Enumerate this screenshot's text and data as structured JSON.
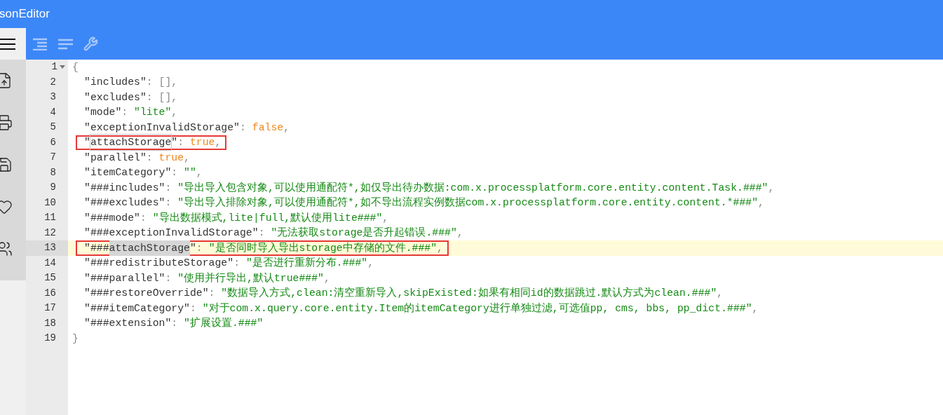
{
  "window": {
    "title": "sonEditor"
  },
  "editor": {
    "open": {
      "number": "1",
      "text": "{"
    },
    "entries": [
      {
        "number": "2",
        "active": false,
        "framed": false,
        "tokens": [
          {
            "kind": "key",
            "text": "\"includes\""
          },
          {
            "kind": "punct",
            "text": ": "
          },
          {
            "kind": "punct",
            "text": "[],"
          }
        ]
      },
      {
        "number": "3",
        "active": false,
        "framed": false,
        "tokens": [
          {
            "kind": "key",
            "text": "\"excludes\""
          },
          {
            "kind": "punct",
            "text": ": "
          },
          {
            "kind": "punct",
            "text": "[],"
          }
        ]
      },
      {
        "number": "4",
        "active": false,
        "framed": false,
        "tokens": [
          {
            "kind": "key",
            "text": "\"mode\""
          },
          {
            "kind": "punct",
            "text": ": "
          },
          {
            "kind": "string",
            "text": "\"lite\""
          },
          {
            "kind": "punct",
            "text": ","
          }
        ]
      },
      {
        "number": "5",
        "active": false,
        "framed": false,
        "tokens": [
          {
            "kind": "key",
            "text": "\"exceptionInvalidStorage\""
          },
          {
            "kind": "punct",
            "text": ": "
          },
          {
            "kind": "bool",
            "text": "false"
          },
          {
            "kind": "punct",
            "text": ","
          }
        ]
      },
      {
        "number": "6",
        "active": false,
        "framed": true,
        "tokens": [
          {
            "kind": "key",
            "text": "\""
          },
          {
            "kind": "key",
            "text": "attachStorage",
            "outlined": true,
            "selected": false
          },
          {
            "kind": "key",
            "text": "\""
          },
          {
            "kind": "punct",
            "text": ": "
          },
          {
            "kind": "bool",
            "text": "true"
          },
          {
            "kind": "punct",
            "text": ","
          }
        ]
      },
      {
        "number": "7",
        "active": false,
        "framed": false,
        "tokens": [
          {
            "kind": "key",
            "text": "\"parallel\""
          },
          {
            "kind": "punct",
            "text": ": "
          },
          {
            "kind": "bool",
            "text": "true"
          },
          {
            "kind": "punct",
            "text": ","
          }
        ]
      },
      {
        "number": "8",
        "active": false,
        "framed": false,
        "tokens": [
          {
            "kind": "key",
            "text": "\"itemCategory\""
          },
          {
            "kind": "punct",
            "text": ": "
          },
          {
            "kind": "string",
            "text": "\"\""
          },
          {
            "kind": "punct",
            "text": ","
          }
        ]
      },
      {
        "number": "9",
        "active": false,
        "framed": false,
        "tokens": [
          {
            "kind": "key",
            "text": "\"###includes\""
          },
          {
            "kind": "punct",
            "text": ": "
          },
          {
            "kind": "string",
            "text": "\"导出导入包含对象,可以使用通配符*,如仅导出待办数据:com.x.processplatform.core.entity.content.Task.###\""
          },
          {
            "kind": "punct",
            "text": ","
          }
        ]
      },
      {
        "number": "10",
        "active": false,
        "framed": false,
        "tokens": [
          {
            "kind": "key",
            "text": "\"###excludes\""
          },
          {
            "kind": "punct",
            "text": ": "
          },
          {
            "kind": "string",
            "text": "\"导出导入排除对象,可以使用通配符*,如不导出流程实例数据com.x.processplatform.core.entity.content.*###\""
          },
          {
            "kind": "punct",
            "text": ","
          }
        ]
      },
      {
        "number": "11",
        "active": false,
        "framed": false,
        "tokens": [
          {
            "kind": "key",
            "text": "\"###mode\""
          },
          {
            "kind": "punct",
            "text": ": "
          },
          {
            "kind": "string",
            "text": "\"导出数据模式,lite|full,默认使用lite###\""
          },
          {
            "kind": "punct",
            "text": ","
          }
        ]
      },
      {
        "number": "12",
        "active": false,
        "framed": false,
        "tokens": [
          {
            "kind": "key",
            "text": "\"###exceptionInvalidStorage\""
          },
          {
            "kind": "punct",
            "text": ": "
          },
          {
            "kind": "string",
            "text": "\"无法获取storage是否升起错误.###\""
          },
          {
            "kind": "punct",
            "text": ","
          }
        ]
      },
      {
        "number": "13",
        "active": true,
        "framed": true,
        "tokens": [
          {
            "kind": "key",
            "text": "\"###"
          },
          {
            "kind": "key",
            "text": "attachStorage",
            "outlined": false,
            "selected": true
          },
          {
            "kind": "key",
            "text": "\""
          },
          {
            "kind": "punct",
            "text": ": "
          },
          {
            "kind": "string",
            "text": "\"是否同时导入导出storage中存储的文件.###\""
          },
          {
            "kind": "punct",
            "text": ","
          }
        ]
      },
      {
        "number": "14",
        "active": false,
        "framed": false,
        "tokens": [
          {
            "kind": "key",
            "text": "\"###redistributeStorage\""
          },
          {
            "kind": "punct",
            "text": ": "
          },
          {
            "kind": "string",
            "text": "\"是否进行重新分布.###\""
          },
          {
            "kind": "punct",
            "text": ","
          }
        ]
      },
      {
        "number": "15",
        "active": false,
        "framed": false,
        "tokens": [
          {
            "kind": "key",
            "text": "\"###parallel\""
          },
          {
            "kind": "punct",
            "text": ": "
          },
          {
            "kind": "string",
            "text": "\"使用并行导出,默认true###\""
          },
          {
            "kind": "punct",
            "text": ","
          }
        ]
      },
      {
        "number": "16",
        "active": false,
        "framed": false,
        "tokens": [
          {
            "kind": "key",
            "text": "\"###restoreOverride\""
          },
          {
            "kind": "punct",
            "text": ": "
          },
          {
            "kind": "string",
            "text": "\"数据导入方式,clean:清空重新导入,skipExisted:如果有相同id的数据跳过.默认方式为clean.###\""
          },
          {
            "kind": "punct",
            "text": ","
          }
        ]
      },
      {
        "number": "17",
        "active": false,
        "framed": false,
        "tokens": [
          {
            "kind": "key",
            "text": "\"###itemCategory\""
          },
          {
            "kind": "punct",
            "text": ": "
          },
          {
            "kind": "string",
            "text": "\"对于com.x.query.core.entity.Item的itemCategory进行单独过滤,可选值pp, cms, bbs, pp_dict.###\""
          },
          {
            "kind": "punct",
            "text": ","
          }
        ]
      },
      {
        "number": "18",
        "active": false,
        "framed": false,
        "tokens": [
          {
            "kind": "key",
            "text": "\"###extension\""
          },
          {
            "kind": "punct",
            "text": ": "
          },
          {
            "kind": "string",
            "text": "\"扩展设置.###\""
          }
        ]
      }
    ],
    "close": {
      "number": "19",
      "text": "}"
    }
  }
}
